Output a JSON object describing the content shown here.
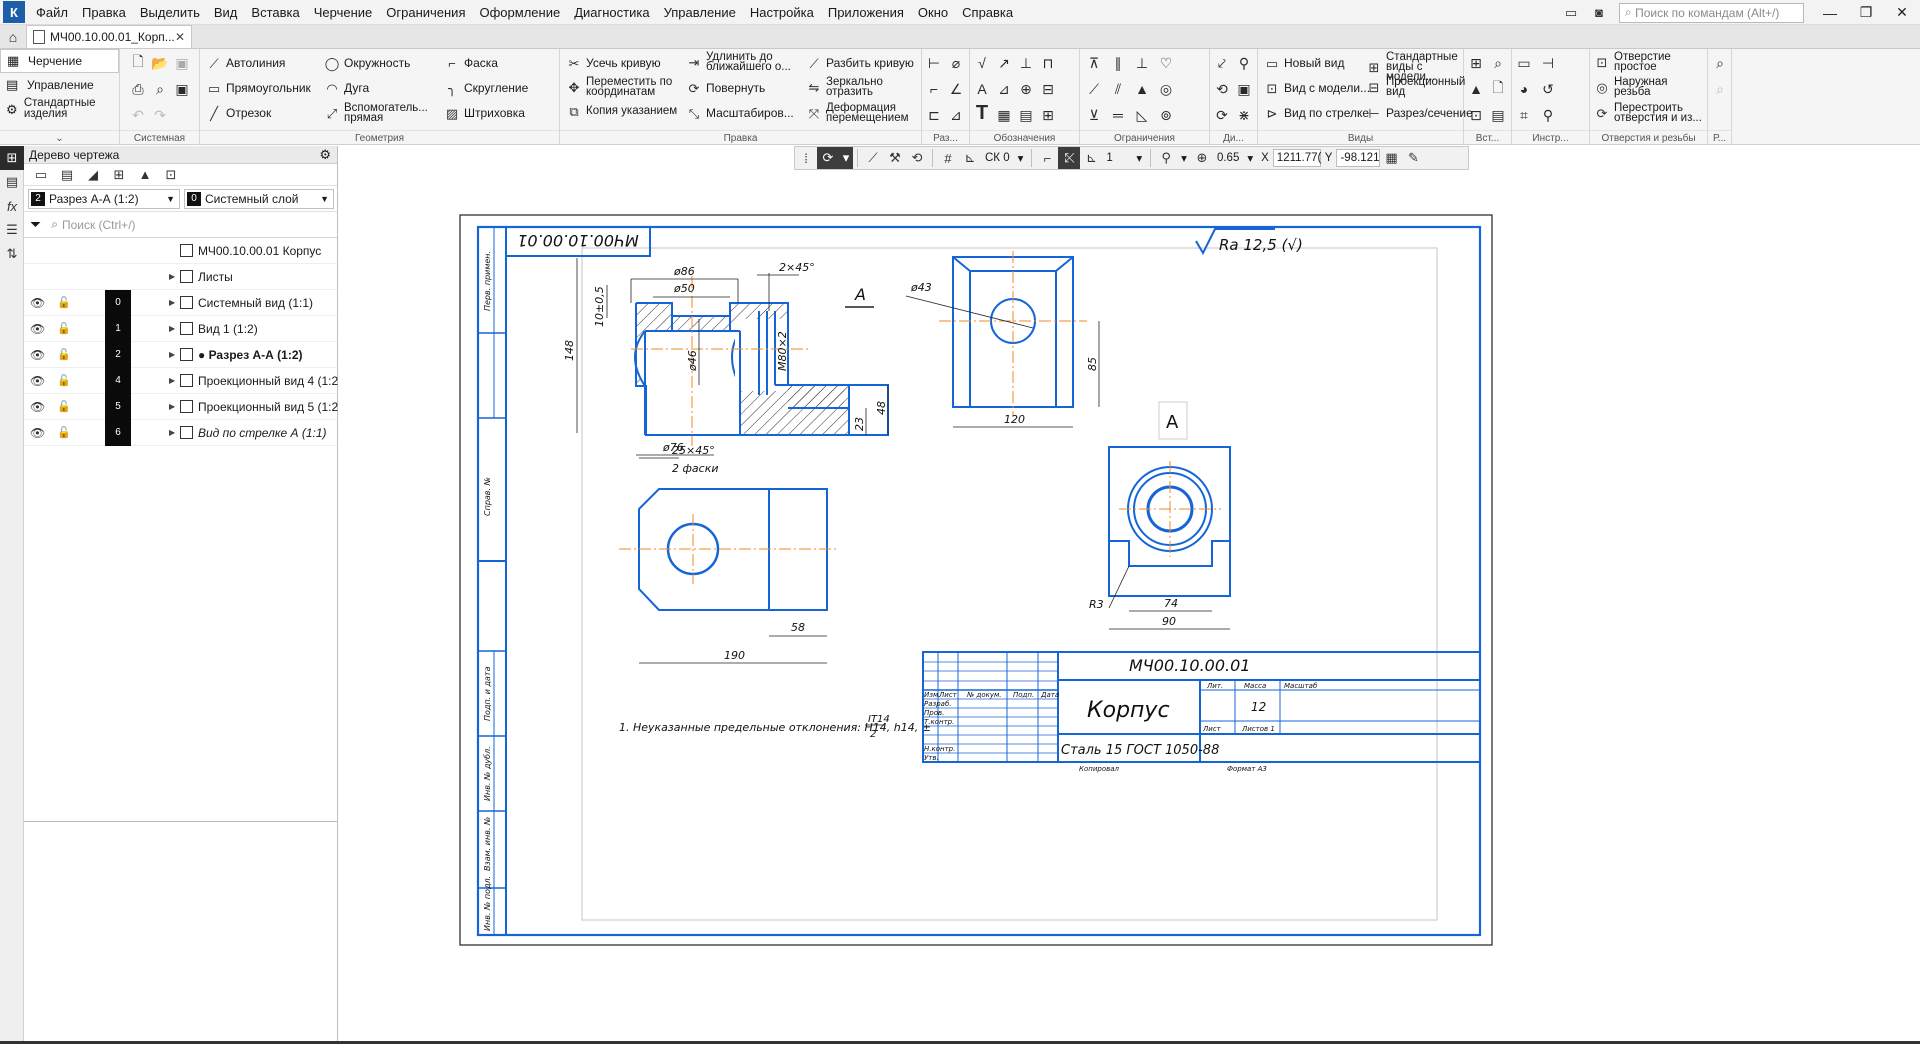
{
  "menu": {
    "items": [
      "Файл",
      "Правка",
      "Выделить",
      "Вид",
      "Вставка",
      "Черчение",
      "Ограничения",
      "Оформление",
      "Диагностика",
      "Управление",
      "Настройка",
      "Приложения",
      "Окно",
      "Справка"
    ],
    "search_placeholder": "Поиск по командам (Alt+/)"
  },
  "tabs": {
    "document": "МЧ00.10.00.01_Корп..."
  },
  "ribbon": {
    "contexts": [
      "Черчение",
      "Управление",
      "Стандартные изделия"
    ],
    "groups": [
      "Системная",
      "Геометрия",
      "Правка",
      "Раз...",
      "Обозначения",
      "Ограничения",
      "Ди...",
      "Виды",
      "Вст...",
      "Инстр...",
      "Отверстия и резьбы",
      "Р..."
    ],
    "geometry": [
      "Автолиния",
      "Окружность",
      "Фаска",
      "Прямоугольник",
      "Дуга",
      "Скругление",
      "Отрезок",
      "Вспомогатель... прямая",
      "Штриховка"
    ],
    "edit": [
      "Усечь кривую",
      "Удлинить до ближайшего о...",
      "Разбить кривую",
      "Переместить по координатам",
      "Повернуть",
      "Зеркально отразить",
      "Копия указанием",
      "Масштабиров...",
      "Деформация перемещением"
    ],
    "views": [
      "Новый вид",
      "Стандартные виды с модели...",
      "Вид с модели...",
      "Проекционный вид",
      "Вид по стрелке",
      "Разрез/сечение"
    ],
    "holes": [
      "Отверстие простое",
      "Наружная резьба",
      "Перестроить отверстия и из..."
    ]
  },
  "draw_toolbar": {
    "cs": "СК 0",
    "step": "1",
    "zoom": "0.65",
    "x": "1211.77(",
    "y": "-98.121"
  },
  "tree": {
    "title": "Дерево чертежа",
    "view_select": {
      "num": "2",
      "label": "Разрез А-А (1:2)"
    },
    "layer_select": {
      "num": "0",
      "label": "Системный слой"
    },
    "search_placeholder": "Поиск (Ctrl+/)",
    "root": "МЧ00.10.00.01 Корпус",
    "sheets": "Листы",
    "items": [
      {
        "num": "0",
        "label": "Системный вид (1:1)"
      },
      {
        "num": "1",
        "label": "Вид 1 (1:2)"
      },
      {
        "num": "2",
        "label": "● Разрез А-А (1:2)"
      },
      {
        "num": "4",
        "label": "Проекционный вид 4 (1:2)"
      },
      {
        "num": "5",
        "label": "Проекционный вид 5 (1:2)"
      },
      {
        "num": "6",
        "label": "Вид по стрелке А (1:1)"
      }
    ]
  },
  "drawing": {
    "designation": "МЧ00.10.00.01",
    "name": "Корпус",
    "material": "Сталь 15  ГОСТ 1050-88",
    "mass": "12",
    "roughness": "Ra 12,5 (√)",
    "note": "1. Неуказанные предельные отклонения: H14, h14, ±",
    "note_frac_num": "IT14",
    "note_frac_den": "2",
    "copy": "Копировал",
    "format": "Формат   А3",
    "arrow_label": "А",
    "dims": {
      "d86": "ø86",
      "d50": "ø50",
      "chamfer1": "2×45°",
      "h10": "10±0,5",
      "h148": "148",
      "d46": "ø46",
      "m80": "M80×2",
      "d76": "ø76",
      "d43": "ø43",
      "h85": "85",
      "w120": "120",
      "h23": "23",
      "h48": "48",
      "chamfer2": "25×45°",
      "chamfer2b": "2 фаски",
      "w58": "58",
      "w190": "190",
      "r3": "R3",
      "w74": "74",
      "w90": "90"
    },
    "titleblock": {
      "col_heads": [
        "Изм.",
        "Лист",
        "№ докум.",
        "Подп.",
        "Дата"
      ],
      "rows": [
        "Разраб.",
        "Пров.",
        "Т.контр.",
        "Н.контр.",
        "Утв."
      ],
      "lit": "Лит.",
      "massa": "Масса",
      "scale": "Масштаб",
      "list": "Лист",
      "listov": "Листов 1"
    },
    "side_labels": [
      "Перв. примен.",
      "Справ. №",
      "Подп. и дата",
      "Инв. № дубл.",
      "Взам. инв. №",
      "Подп. и дата",
      "Инв. № подл."
    ]
  }
}
